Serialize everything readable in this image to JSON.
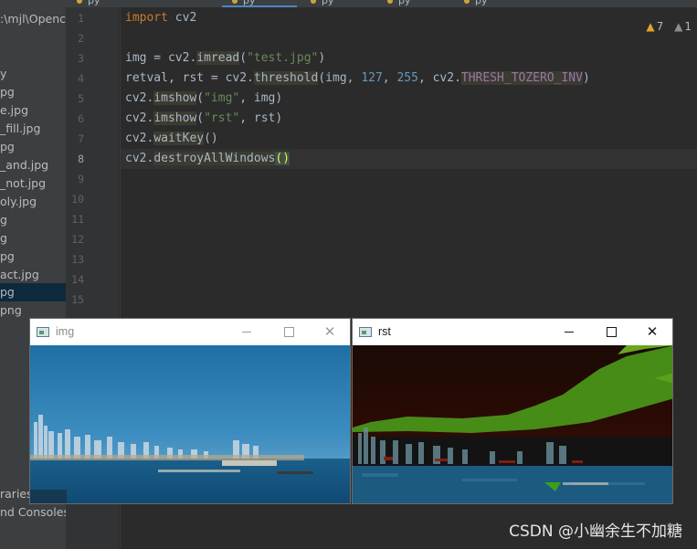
{
  "tabs": [
    {
      "label": "py"
    },
    {
      "label": "py"
    },
    {
      "label": "py"
    },
    {
      "label": "py"
    },
    {
      "label": "py"
    }
  ],
  "project_tree": {
    "path_label": ":\\mjl\\Opencv",
    "items": [
      {
        "label": "y"
      },
      {
        "label": "pg"
      },
      {
        "label": "e.jpg"
      },
      {
        "label": "_fill.jpg"
      },
      {
        "label": "pg"
      },
      {
        "label": "_and.jpg"
      },
      {
        "label": "_not.jpg"
      },
      {
        "label": "oly.jpg"
      },
      {
        "label": "g"
      },
      {
        "label": "g"
      },
      {
        "label": "pg"
      },
      {
        "label": "act.jpg"
      },
      {
        "label": "pg",
        "selected": true
      },
      {
        "label": "png"
      }
    ],
    "footer_items": [
      {
        "label": "raries"
      },
      {
        "label": "nd Consoles"
      }
    ]
  },
  "line_numbers": [
    "1",
    "2",
    "3",
    "4",
    "5",
    "6",
    "7",
    "8",
    "9",
    "10",
    "11",
    "12",
    "13",
    "14",
    "15"
  ],
  "current_line": 8,
  "code": {
    "l1_kw": "import",
    "l1_rest": " cv2",
    "l3_a": "img = cv2.",
    "l3_fn": "imread",
    "l3_b": "(",
    "l3_str": "\"test.jpg\"",
    "l3_c": ")",
    "l4_a": "retval, rst = cv2.",
    "l4_fn": "threshold",
    "l4_b": "(img, ",
    "l4_n1": "127",
    "l4_c": ", ",
    "l4_n2": "255",
    "l4_d": ", cv2.",
    "l4_con": "THRESH_TOZERO_INV",
    "l4_e": ")",
    "l5_a": "cv2.",
    "l5_fn": "imshow",
    "l5_b": "(",
    "l5_str": "\"img\"",
    "l5_c": ", img)",
    "l6_a": "cv2.",
    "l6_fn": "imshow",
    "l6_b": "(",
    "l6_str": "\"rst\"",
    "l6_c": ", rst)",
    "l7_a": "cv2.",
    "l7_fn": "waitKey",
    "l7_b": "()",
    "l8_a": "cv2.",
    "l8_fn": "destroyAllWindows",
    "l8_paren": "()"
  },
  "inspections": {
    "warnings": "7",
    "weak_warnings": "1",
    "warn_icon": "warning-triangle-icon",
    "weak_icon": "weak-warning-triangle-icon"
  },
  "windows": {
    "img": {
      "title": "img",
      "minimize": "—",
      "close": "✕"
    },
    "rst": {
      "title": "rst",
      "minimize": "—",
      "close": "✕"
    }
  },
  "watermark": "CSDN @小幽余生不加糖",
  "colors": {
    "editor_bg": "#2b2b2b",
    "keyword": "#cc7832",
    "string": "#6a8759",
    "number": "#6897bb",
    "constant": "#9876aa",
    "selection": "#0d293e"
  }
}
